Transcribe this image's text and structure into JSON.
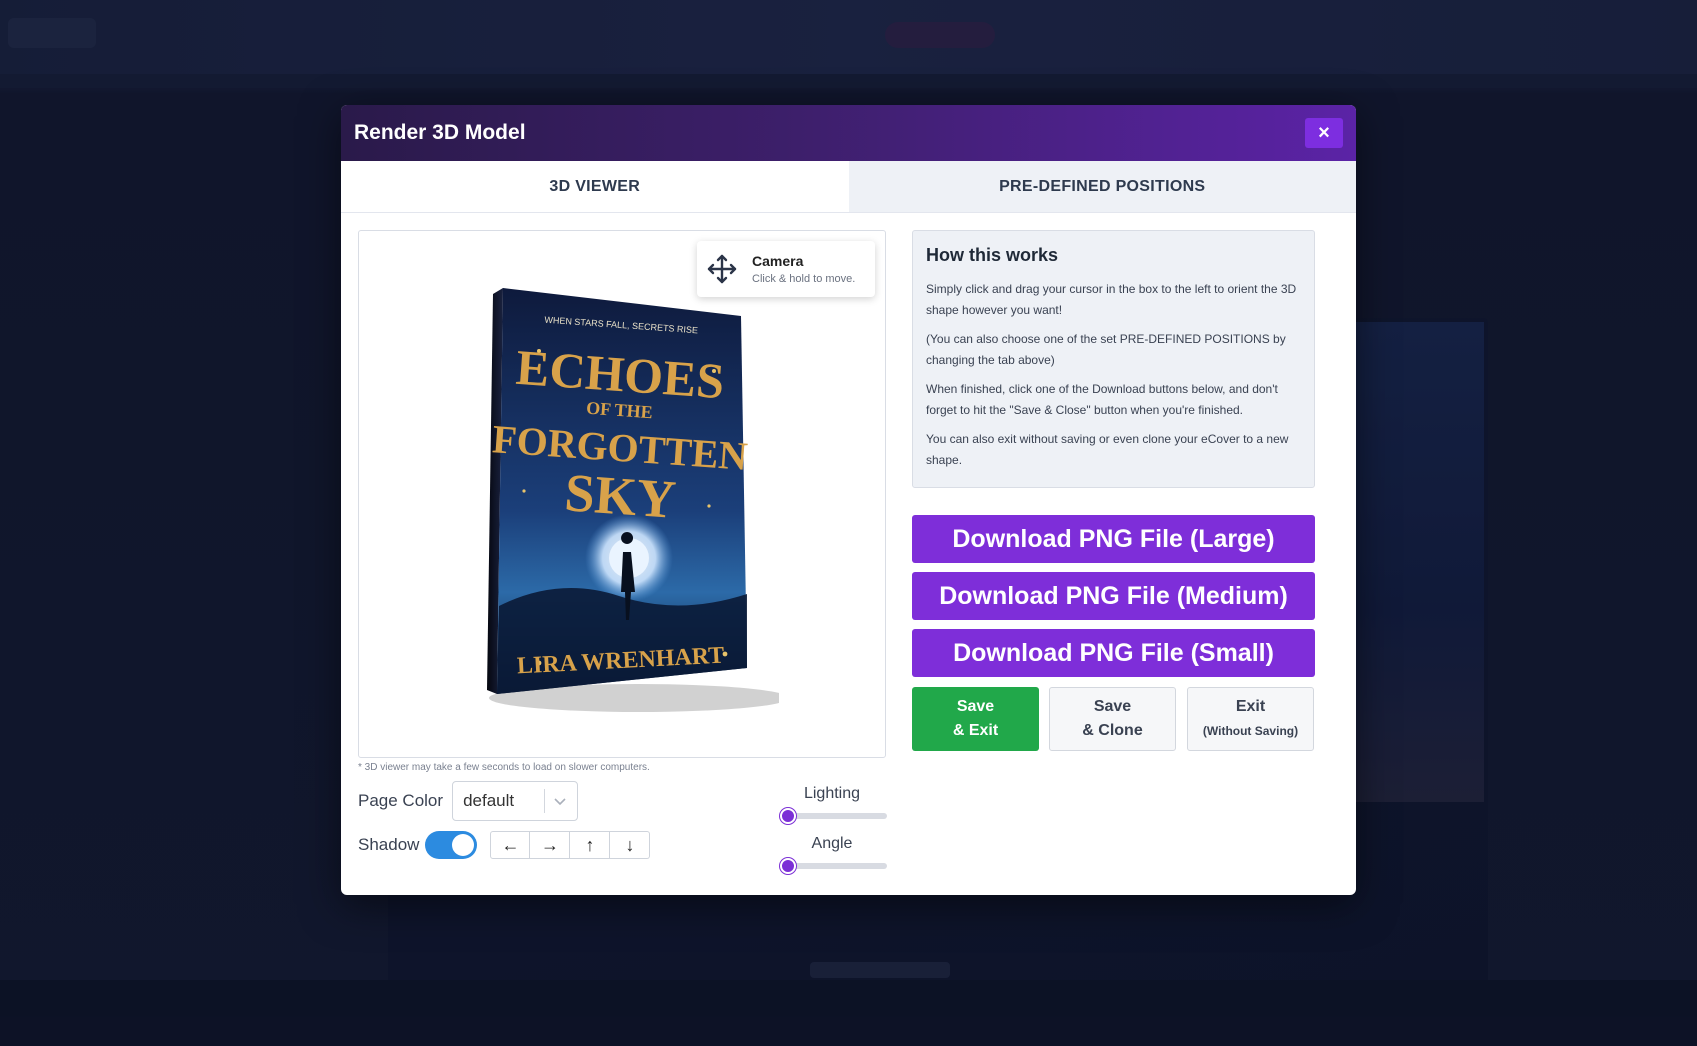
{
  "modal": {
    "title": "Render 3D Model",
    "close_label": "×"
  },
  "tabs": [
    {
      "label": "3D VIEWER",
      "active": true
    },
    {
      "label": "PRE-DEFINED POSITIONS",
      "active": false
    }
  ],
  "viewer": {
    "camera_title": "Camera",
    "camera_hint": "Click & hold to move.",
    "note": "* 3D viewer may take a few seconds to load on slower computers.",
    "book": {
      "tagline": "WHEN STARS FALL, SECRETS RISE",
      "title_line1": "ECHOES",
      "title_line2": "OF THE",
      "title_line3": "FORGOTTEN",
      "title_line4": "SKY",
      "author": "LIRA WRENHART"
    }
  },
  "controls": {
    "page_color_label": "Page Color",
    "page_color_value": "default",
    "shadow_label": "Shadow",
    "shadow_on": true,
    "arrows": [
      "←",
      "→",
      "↑",
      "↓"
    ],
    "lighting_label": "Lighting",
    "lighting_value": 0,
    "angle_label": "Angle",
    "angle_value": 0
  },
  "info": {
    "heading": "How this works",
    "paragraphs": [
      "Simply click and drag your cursor in the box to the left to orient the 3D shape however you want!",
      "(You can also choose one of the set PRE-DEFINED POSITIONS by changing the tab above)",
      "When finished, click one of the Download buttons below, and don't forget to hit the \"Save & Close\" button when you're finished.",
      "You can also exit without saving or even clone your eCover to a new shape."
    ]
  },
  "downloads": [
    "Download PNG File (Large)",
    "Download PNG File (Medium)",
    "Download PNG File (Small)"
  ],
  "actions": {
    "save_exit_line1": "Save",
    "save_exit_line2": "& Exit",
    "save_clone_line1": "Save",
    "save_clone_line2": "& Clone",
    "exit_line1": "Exit",
    "exit_line2": "(Without Saving)"
  },
  "colors": {
    "accent": "#7e2ed9",
    "save_green": "#21a84a",
    "toggle_blue": "#2c8be0"
  }
}
